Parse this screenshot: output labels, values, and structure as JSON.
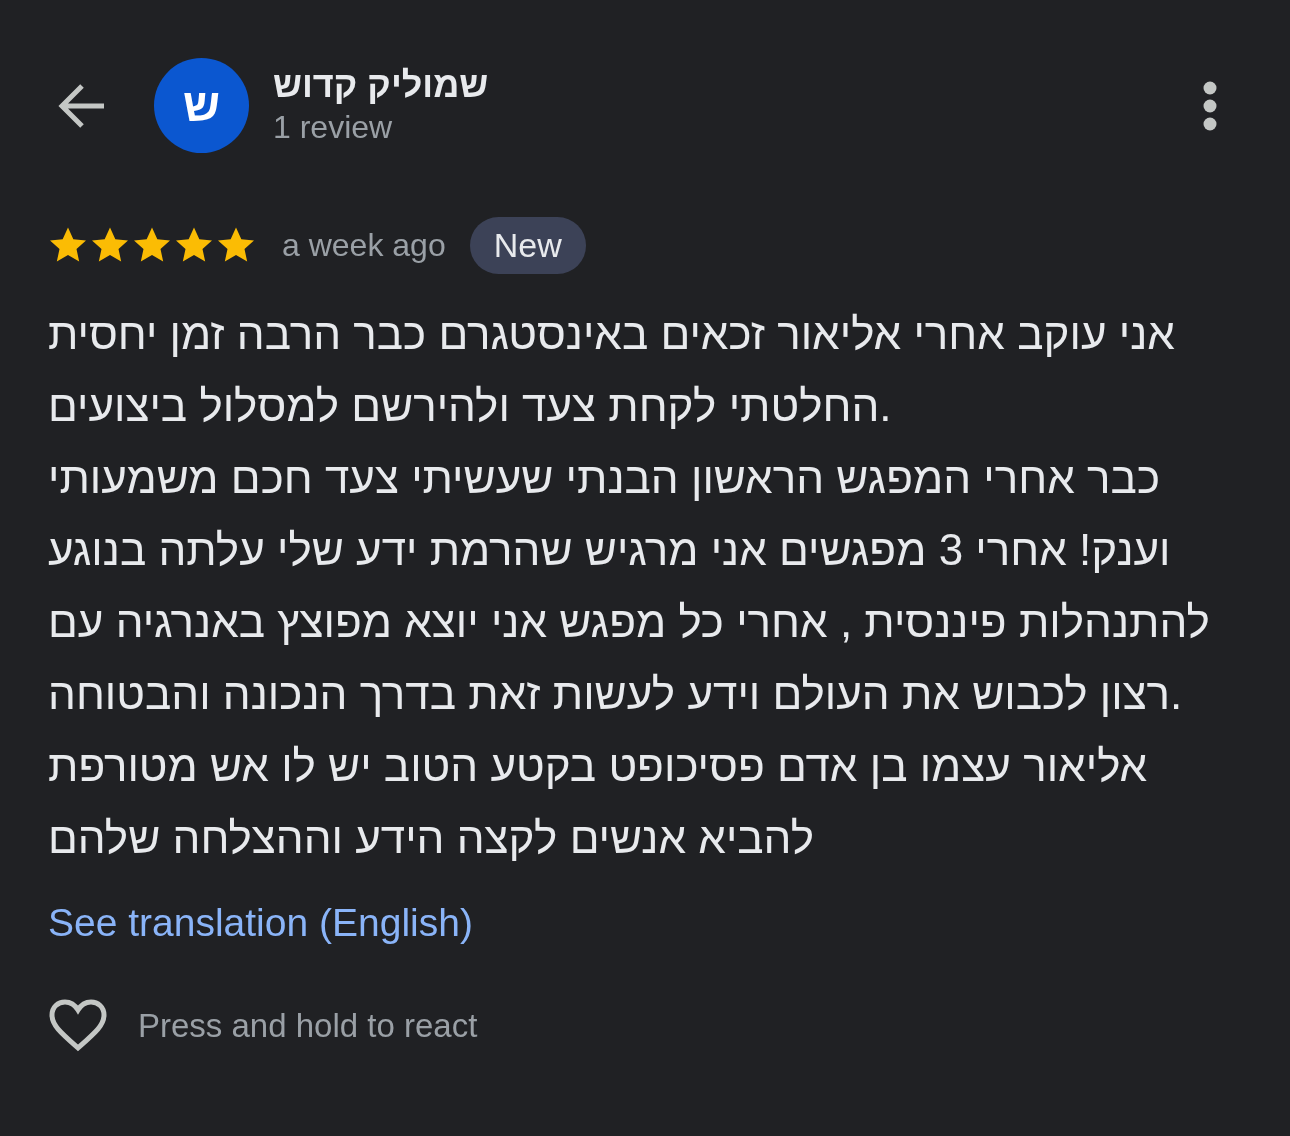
{
  "header": {
    "avatar_letter": "ש",
    "name": "שמוליק קדוש",
    "review_count": "1 review"
  },
  "review": {
    "stars": 5,
    "time": "a week ago",
    "badge": "New",
    "text": "אני עוקב אחרי אליאור זכאים באינסטגרם כבר הרבה זמן יחסית\nהחלטתי לקחת צעד ולהירשם למסלול ביצועים.\nכבר אחרי המפגש הראשון הבנתי שעשיתי צעד חכם משמעותי\nוענק! אחרי 3 מפגשים אני מרגיש שהרמת ידע שלי עלתה בנוגע\nלהתנהלות פיננסית , אחרי כל מפגש אני יוצא מפוצץ באנרגיה עם\nרצון לכבוש את העולם וידע לעשות זאת בדרך הנכונה והבטוחה.\nאליאור עצמו בן אדם פסיכופט בקטע הטוב יש לו אש מטורפת\nלהביא אנשים לקצה הידע וההצלחה שלהם",
    "translation_link": "See translation (English)"
  },
  "react": {
    "label": "Press and hold to react"
  }
}
